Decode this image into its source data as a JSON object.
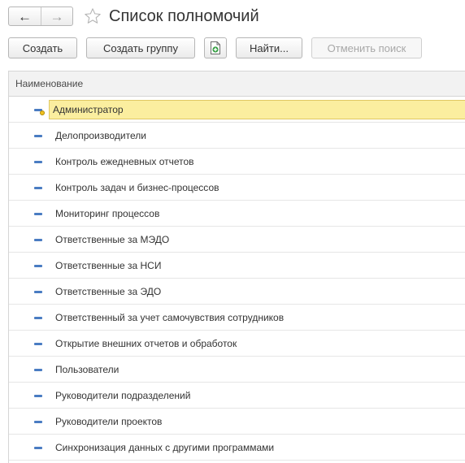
{
  "title": "Список полномочий",
  "nav": {
    "back_glyph": "←",
    "forward_glyph": "→"
  },
  "toolbar": {
    "create": "Создать",
    "create_group": "Создать группу",
    "find": "Найти...",
    "cancel_search": "Отменить поиск"
  },
  "table": {
    "column_header": "Наименование",
    "rows": [
      {
        "label": "Администратор",
        "selected": true,
        "icon": "role-main-icon"
      },
      {
        "label": "Делопроизводители",
        "icon": "role-icon"
      },
      {
        "label": "Контроль ежедневных отчетов",
        "icon": "role-icon"
      },
      {
        "label": "Контроль задач и бизнес-процессов",
        "icon": "role-icon"
      },
      {
        "label": "Мониторинг процессов",
        "icon": "role-icon"
      },
      {
        "label": "Ответственные за МЭДО",
        "icon": "role-icon"
      },
      {
        "label": "Ответственные за НСИ",
        "icon": "role-icon"
      },
      {
        "label": "Ответственные за ЭДО",
        "icon": "role-icon"
      },
      {
        "label": "Ответственный за учет самочувствия сотрудников",
        "icon": "role-icon"
      },
      {
        "label": "Открытие внешних отчетов и обработок",
        "icon": "role-icon"
      },
      {
        "label": "Пользователи",
        "icon": "role-icon"
      },
      {
        "label": "Руководители подразделений",
        "icon": "role-icon"
      },
      {
        "label": "Руководители проектов",
        "icon": "role-icon"
      },
      {
        "label": "Синхронизация данных с другими программами",
        "icon": "role-icon"
      }
    ]
  },
  "colors": {
    "selection_fill": "#fbee9f",
    "icon_blue": "#4a7cc2",
    "main_marker": "#f0c020"
  }
}
